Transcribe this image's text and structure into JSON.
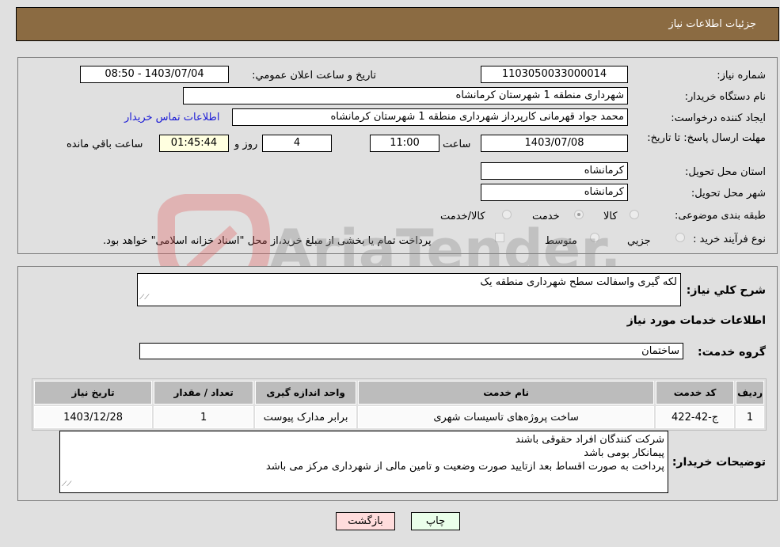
{
  "header": {
    "title": "جزئیات اطلاعات نیاز"
  },
  "details": {
    "need_number_label": "شماره نیاز:",
    "need_number": "1103050033000014",
    "announce_label": "تاریخ و ساعت اعلان عمومي:",
    "announce_value": "1403/07/04 - 08:50",
    "buyer_org_label": "نام دستگاه خریدار:",
    "buyer_org": "شهرداری منطقه 1 شهرستان کرمانشاه",
    "creator_label": "ایجاد کننده درخواست:",
    "creator": "محمد جواد قهرمانی کارپرداز شهرداری منطقه 1 شهرستان کرمانشاه",
    "contact_link": "اطلاعات تماس خریدار",
    "deadline_label": "مهلت ارسال پاسخ: تا تاریخ:",
    "deadline_date": "1403/07/08",
    "time_label": "ساعت",
    "deadline_time": "11:00",
    "days_value": "4",
    "days_label": "روز و",
    "remaining_time": "01:45:44",
    "remaining_label": "ساعت باقي مانده",
    "province_label": "استان محل تحویل:",
    "province": "کرمانشاه",
    "city_label": "شهر محل تحویل:",
    "city": "کرمانشاه",
    "category_label": "طبقه بندی موضوعی:",
    "category_options": [
      {
        "label": "کالا",
        "selected": false
      },
      {
        "label": "خدمت",
        "selected": true
      },
      {
        "label": "کالا/خدمت",
        "selected": false
      }
    ],
    "process_label": "نوع فرآیند خرید :",
    "process_options": [
      {
        "label": "جزيي",
        "selected": false
      },
      {
        "label": "متوسط",
        "selected": false
      }
    ],
    "payment_note": "پرداخت تمام یا بخشی از مبلغ خرید،از محل \"اسناد خزانه اسلامی\" خواهد بود."
  },
  "summary": {
    "description_label": "شرح کلي نیاز:",
    "description": "لکه گیری واسفالت سطح شهرداری منطقه یک",
    "services_heading": "اطلاعات خدمات مورد نیاز",
    "service_group_label": "گروه خدمت:",
    "service_group": "ساختمان"
  },
  "table": {
    "columns": [
      "ردیف",
      "کد خدمت",
      "نام خدمت",
      "واحد اندازه گیری",
      "تعداد / مقدار",
      "تاریخ نیاز"
    ],
    "rows": [
      [
        "1",
        "ج-42-422",
        "ساخت پروژه‌های تاسیسات شهری",
        "برابر مدارک پیوست",
        "1",
        "1403/12/28"
      ]
    ]
  },
  "buyer_notes": {
    "label": "توضیحات خریدار:",
    "lines": [
      "شرکت کنندگان افراد حقوقی باشند",
      "پیمانکار بومی باشد",
      "پرداخت به صورت اقساط بعد ازتایید صورت وضعیت و تامین مالی از شهرداری مرکز می باشد"
    ]
  },
  "buttons": {
    "print": "چاپ",
    "back": "بازگشت"
  },
  "colors": {
    "header_bg": "#8b6b42",
    "print_bg": "#eaffea",
    "back_bg": "#ffdcdc",
    "link": "#1a1ad6"
  },
  "watermark": {
    "text": "AriaTender.neT"
  }
}
